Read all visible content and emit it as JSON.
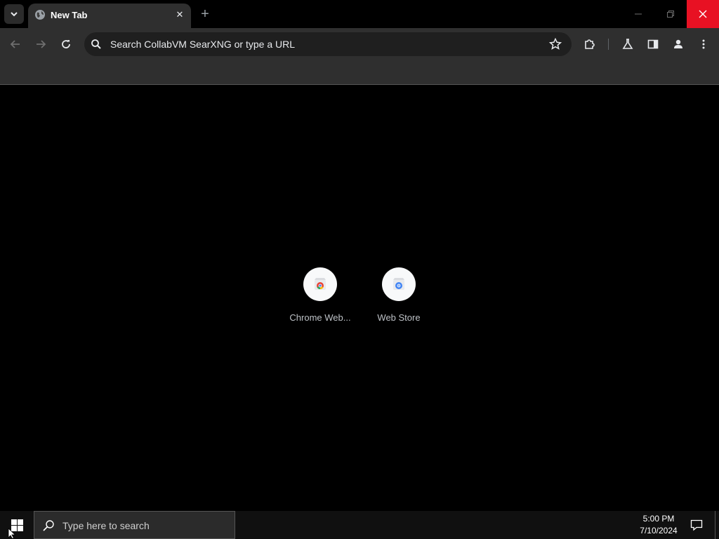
{
  "tab": {
    "title": "New Tab",
    "close_glyph": "✕",
    "new_tab_glyph": "+"
  },
  "omnibox": {
    "placeholder": "Search CollabVM SearXNG or type a URL"
  },
  "shortcuts": [
    {
      "label": "Chrome Web...",
      "icon": "chrome-web-store-icon"
    },
    {
      "label": "Web Store",
      "icon": "web-store-icon"
    }
  ],
  "taskbar": {
    "search_placeholder": "Type here to search",
    "time": "5:00 PM",
    "date": "7/10/2024"
  },
  "colors": {
    "tab_active": "#2f2f2f",
    "toolbar": "#2f2f2f",
    "omnibox": "#1f1f1f",
    "page_background": "#000000",
    "close_hover": "#e81123",
    "taskbar": "#101010"
  }
}
